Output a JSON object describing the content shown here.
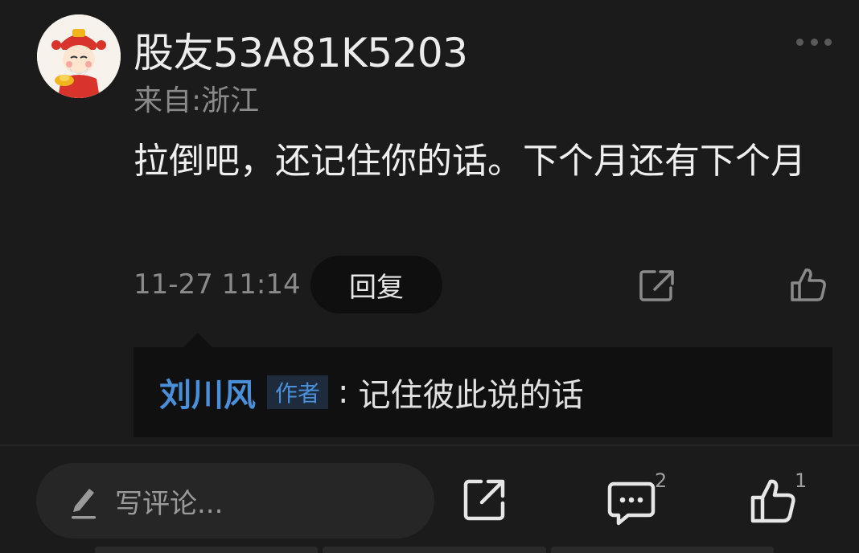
{
  "comment": {
    "username": "股友53A81K5203",
    "location": "来自:浙江",
    "text": "拉倒吧，还记住你的话。下个月还有下个月",
    "time": "11-27 11:14",
    "reply_label": "回复"
  },
  "reply": {
    "author": "刘川风",
    "badge": "作者",
    "separator": ":",
    "text": "记住彼此说的话"
  },
  "bottom_bar": {
    "comment_placeholder": "写评论...",
    "comment_count": "2",
    "like_count": "1"
  },
  "icons": {
    "more": "more-horizontal-icon",
    "share": "share-icon",
    "like": "thumbs-up-icon",
    "pen": "pen-icon",
    "comment": "comment-bubble-icon"
  },
  "colors": {
    "background": "#1b1b1b",
    "author_blue": "#4a8fd9"
  }
}
